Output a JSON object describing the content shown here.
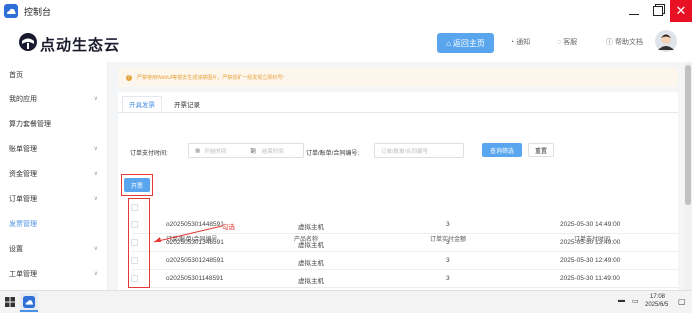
{
  "window": {
    "title": "控制台",
    "close_symbol": "✕"
  },
  "header": {
    "logo_text": "点动生态云",
    "back_button": "返回主页",
    "links": [
      "通知",
      "客服",
      "帮助文档"
    ]
  },
  "sidebar": {
    "items": [
      {
        "label": "首页",
        "has_chevron": false
      },
      {
        "label": "我的应用",
        "has_chevron": true
      },
      {
        "label": "算力套餐管理",
        "has_chevron": false
      },
      {
        "label": "账单管理",
        "has_chevron": true
      },
      {
        "label": "资金管理",
        "has_chevron": true
      },
      {
        "label": "订单管理",
        "has_chevron": true
      },
      {
        "label": "发票管理",
        "has_chevron": false,
        "active": true
      },
      {
        "label": "设置",
        "has_chevron": true
      },
      {
        "label": "工单管理",
        "has_chevron": true
      }
    ]
  },
  "notice": {
    "text": "严禁使用WebUI等搭去生成违禁图片，严禁挖矿一经发现立即封号!"
  },
  "tabs": [
    "开具发票",
    "开票记录"
  ],
  "filters": {
    "pay_time_label": "订单支付时间:",
    "start_placeholder": "开始时间",
    "to_label": "到",
    "end_placeholder": "结束时间",
    "order_no_label": "订单/账单/合同编号:",
    "order_no_placeholder": "订单/账单/合同编号",
    "query_button": "查询筛选",
    "reset_button": "重置"
  },
  "invoice_button": "开票",
  "table": {
    "headers": [
      "订单/账单/合同编号",
      "产品名称",
      "订单实付金额",
      "订单支付时间"
    ],
    "rows": [
      [
        "o202505301448591",
        "虚拟主机",
        "3",
        "2025-05-30 14:49:00"
      ],
      [
        "o202505301348591",
        "虚拟主机",
        "3",
        "2025-05-30 13:49:00"
      ],
      [
        "o202505301248591",
        "虚拟主机",
        "3",
        "2025-05-30 12:49:00"
      ],
      [
        "o202505301148591",
        "虚拟主机",
        "3",
        "2025-05-30 11:49:00"
      ]
    ]
  },
  "annotation": {
    "text": "勾选"
  },
  "taskbar": {
    "time": "17:08",
    "date": "2025/6/5"
  },
  "colors": {
    "accent": "#5aa6ee",
    "annotation_red": "#e53935",
    "notice_bg": "#fdf6ec"
  }
}
